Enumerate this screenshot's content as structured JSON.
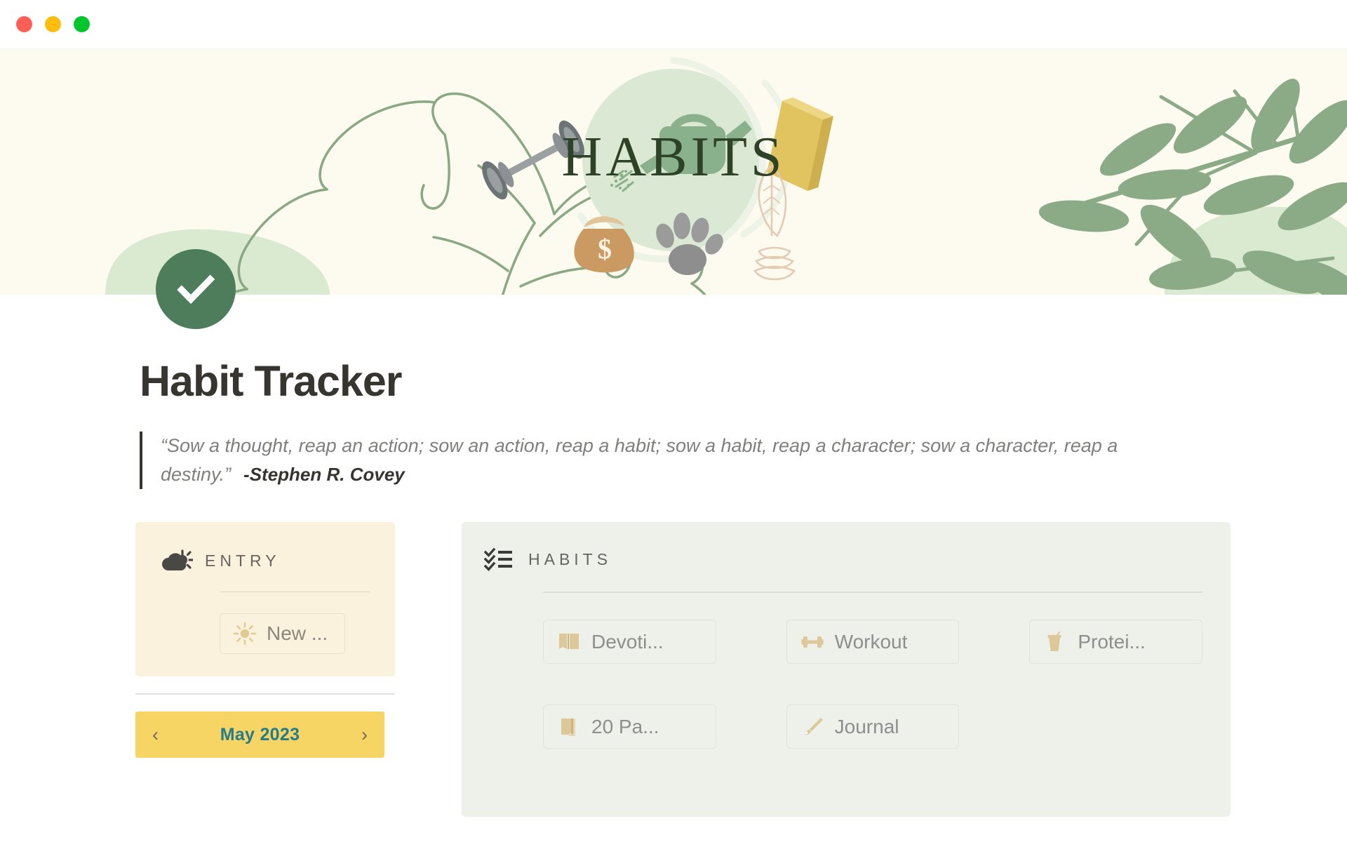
{
  "window": {
    "traffic_lights": [
      {
        "name": "close",
        "color": "#ff5f57"
      },
      {
        "name": "minimize",
        "color": "#ffbd0f"
      },
      {
        "name": "maximize",
        "color": "#00c62b"
      }
    ]
  },
  "banner": {
    "cover_word": "HABITS",
    "background_color": "#fdfaf0",
    "circle_color": "#d9e6d4",
    "leaf_color": "#8aab86",
    "blob_color": "#d9ead0",
    "decor_icons": [
      "dumbbell-icon",
      "watering-can-icon",
      "book-icon",
      "quill-icon",
      "money-bag-icon",
      "paw-print-icon"
    ]
  },
  "page": {
    "icon": "check-circle-icon",
    "icon_color": "#4e7d5c",
    "title": "Habit Tracker",
    "quote": "“Sow a thought, reap an action; sow an action, reap a habit; sow a habit, reap a character; sow a character, reap a destiny.”",
    "quote_author": "-Stephen R. Covey"
  },
  "entry": {
    "icon": "partly-cloudy-icon",
    "title": "ENTRY",
    "background_color": "#faf2dd",
    "new_button": {
      "icon": "sun-icon",
      "label": "New ..."
    }
  },
  "month_nav": {
    "prev_icon": "chevron-left-icon",
    "label": "May 2023",
    "next_icon": "chevron-right-icon",
    "background_color": "#f7d565",
    "text_color": "#267b8c"
  },
  "habits": {
    "icon": "checklist-icon",
    "title": "HABITS",
    "background_color": "#edf1ea",
    "icon_accent_color": "#ddc89a",
    "items": [
      {
        "label": "Devoti...",
        "icon": "open-book-icon"
      },
      {
        "label": "Workout",
        "icon": "dumbbell-icon"
      },
      {
        "label": "Protei...",
        "icon": "protein-shake-icon"
      },
      {
        "label": "20 Pa...",
        "icon": "pages-icon"
      },
      {
        "label": "Journal",
        "icon": "paint-brush-icon"
      }
    ]
  }
}
